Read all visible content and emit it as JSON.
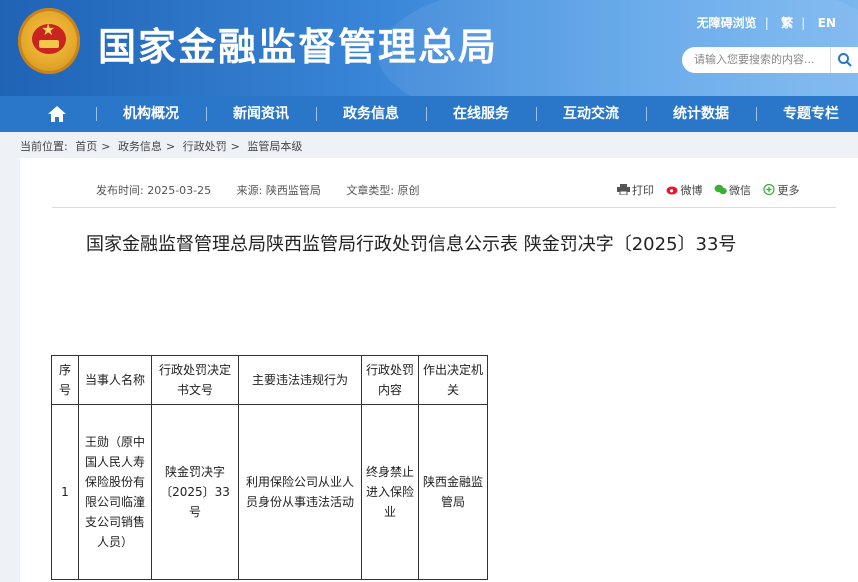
{
  "header": {
    "site_title": "国家金融监督管理总局",
    "top_links": [
      "无障碍浏览",
      "繁",
      "EN"
    ],
    "search_placeholder": "请输入您要搜索的内容..."
  },
  "nav": {
    "items": [
      "机构概况",
      "新闻资讯",
      "政务信息",
      "在线服务",
      "互动交流",
      "统计数据",
      "专题专栏"
    ]
  },
  "breadcrumb": {
    "label": "当前位置:",
    "items": [
      "首页",
      "政务信息",
      "行政处罚",
      "监管局本级"
    ],
    "separator": ">"
  },
  "article": {
    "publish_time": "发布时间: 2025-03-25",
    "source": "来源: 陕西监管局",
    "type": "文章类型: 原创",
    "tools": [
      "打印",
      "微博",
      "微信",
      "更多"
    ],
    "title": "国家金融监督管理总局陕西监管局行政处罚信息公示表 陕金罚决字〔2025〕33号"
  },
  "table": {
    "headers": [
      "序号",
      "当事人名称",
      "行政处罚决定书文号",
      "主要违法违规行为",
      "行政处罚内容",
      "作出决定机关"
    ],
    "row": [
      "1",
      "王勋（原中国人民人寿保险股份有限公司临潼支公司销售人员）",
      "陕金罚决字〔2025〕33号",
      "利用保险公司从业人员身份从事违法活动",
      "终身禁止进入保险业",
      "陕西金融监管局"
    ]
  },
  "colors": {
    "header_start": "#1f63b5",
    "nav": "#2a77c9",
    "page_bg": "#eef2f7"
  }
}
